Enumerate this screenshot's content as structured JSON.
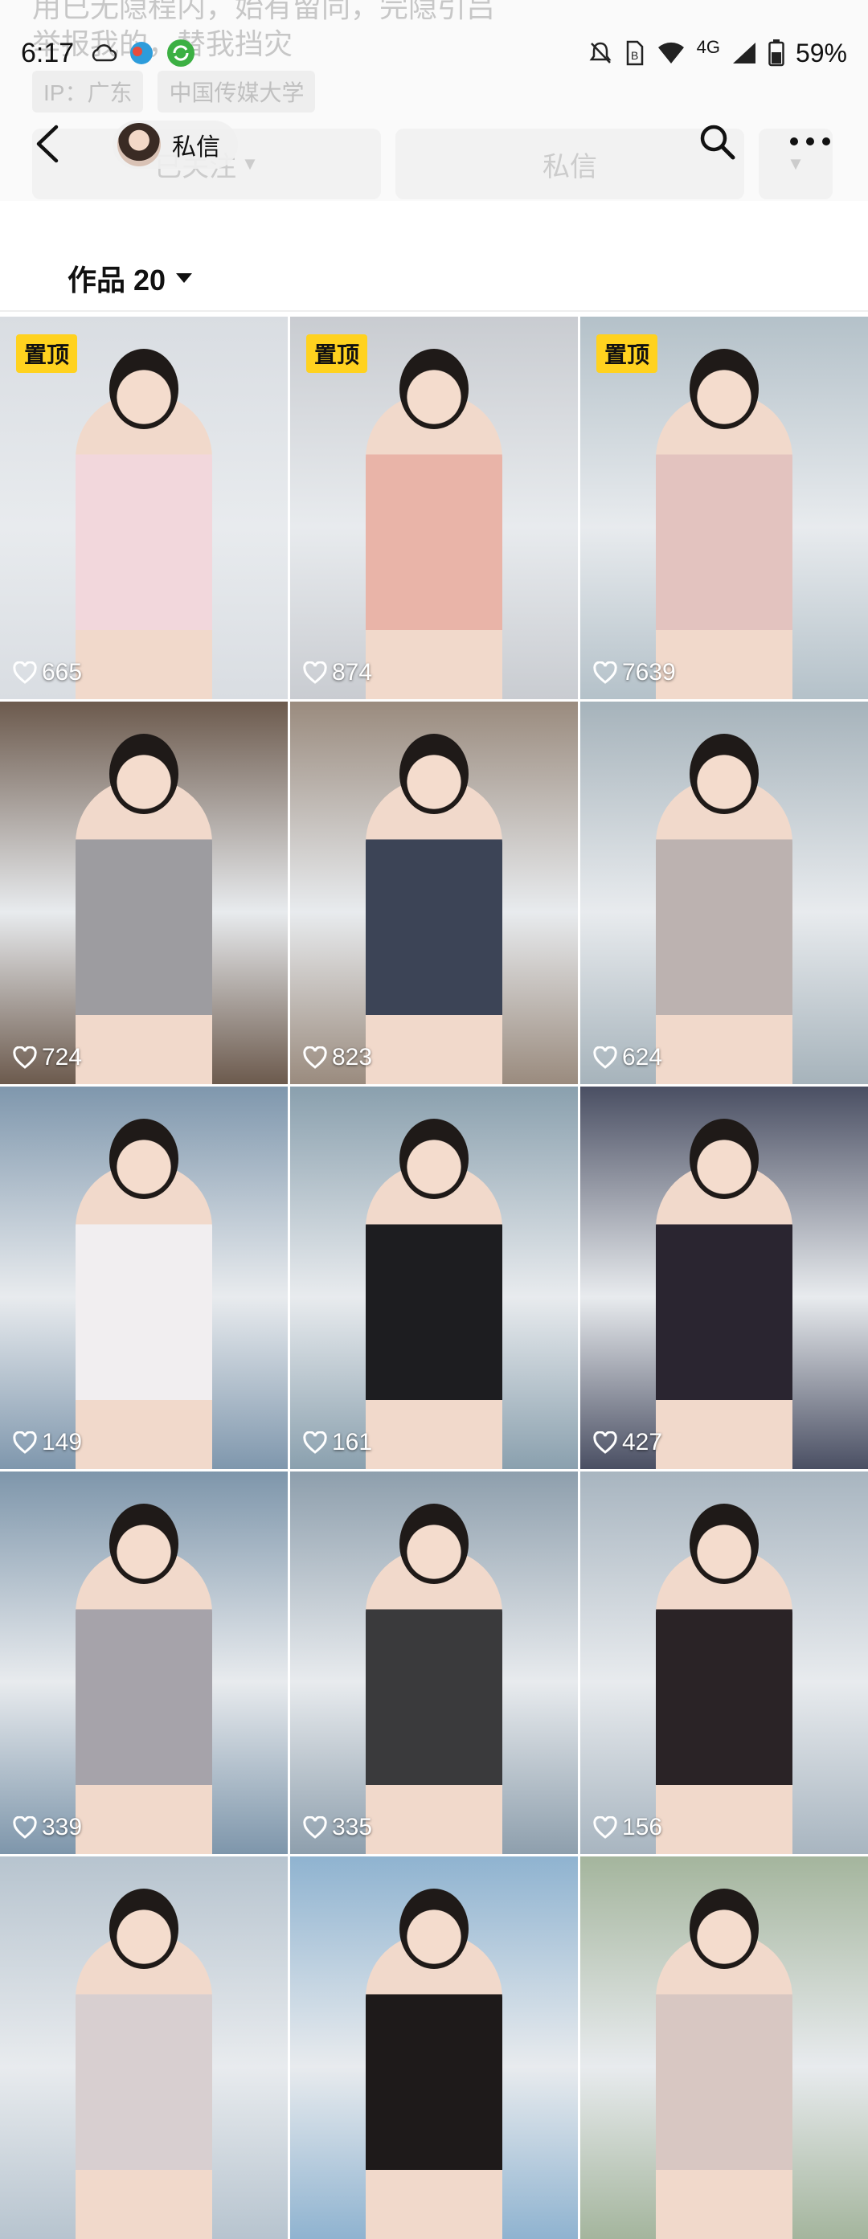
{
  "status_bar": {
    "time": "6:17",
    "network": "4G",
    "battery": "59%"
  },
  "background_profile": {
    "line1": "用已无隐程内，始有留同，完隐引吕",
    "line2": "举报我的，替我挡灾",
    "tags": [
      "IP：广东",
      "中国传媒大学"
    ],
    "buttons": [
      "已关注",
      "私信",
      ""
    ]
  },
  "header": {
    "chip_label": "私信"
  },
  "works": {
    "label": "作品 20"
  },
  "tiles": [
    {
      "likes": "665",
      "pinned": "置顶",
      "tone": "#d9dde2",
      "dress": "#f2d7dc"
    },
    {
      "likes": "874",
      "pinned": "置顶",
      "tone": "#c9ccd1",
      "dress": "#e9b4a8"
    },
    {
      "likes": "7639",
      "pinned": "置顶",
      "tone": "#b4c1c9",
      "dress": "#e3c3bf"
    },
    {
      "likes": "724",
      "pinned": "",
      "tone": "#6c5a4d",
      "dress": "#9d9ca0"
    },
    {
      "likes": "823",
      "pinned": "",
      "tone": "#9a8b7e",
      "dress": "#3c4456"
    },
    {
      "likes": "624",
      "pinned": "",
      "tone": "#a6b3bb",
      "dress": "#bcb2b0"
    },
    {
      "likes": "149",
      "pinned": "",
      "tone": "#7f97ad",
      "dress": "#f1eef0"
    },
    {
      "likes": "161",
      "pinned": "",
      "tone": "#8aa0ae",
      "dress": "#1d1d20"
    },
    {
      "likes": "427",
      "pinned": "",
      "tone": "#4a4f63",
      "dress": "#2a2530"
    },
    {
      "likes": "339",
      "pinned": "",
      "tone": "#7e96ab",
      "dress": "#a6a3aa"
    },
    {
      "likes": "335",
      "pinned": "",
      "tone": "#8e9fad",
      "dress": "#3a3a3c"
    },
    {
      "likes": "156",
      "pinned": "",
      "tone": "#a8b5c0",
      "dress": "#2a2326"
    },
    {
      "likes": "",
      "pinned": "",
      "tone": "#b7c4cf",
      "dress": "#d8cfd0"
    },
    {
      "likes": "",
      "pinned": "",
      "tone": "#8fb3d0",
      "dress": "#1e1a1a"
    },
    {
      "likes": "",
      "pinned": "",
      "tone": "#a4b59d",
      "dress": "#d8c7c2"
    }
  ]
}
